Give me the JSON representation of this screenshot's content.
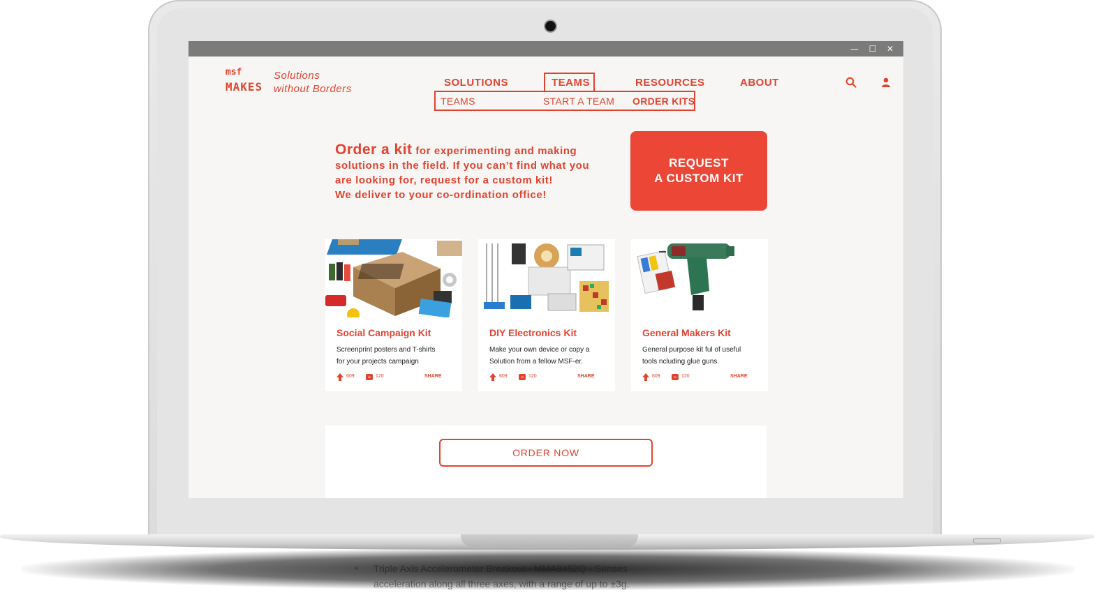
{
  "window": {
    "minimize_glyph": "—",
    "maximize_glyph": "☐",
    "close_glyph": "✕"
  },
  "brand": {
    "logo_top": "msf",
    "logo_bottom": "MAKES",
    "tagline_line1": "Solutions",
    "tagline_line2": "without Borders",
    "accent_color": "#e2432f"
  },
  "nav": {
    "items": [
      {
        "label": "SOLUTIONS"
      },
      {
        "label": "TEAMS"
      },
      {
        "label": "RESOURCES"
      },
      {
        "label": "ABOUT"
      }
    ],
    "active": "TEAMS"
  },
  "submenu": {
    "items": [
      {
        "label": "TEAMS"
      },
      {
        "label": "START A TEAM"
      },
      {
        "label": "ORDER KITS"
      }
    ],
    "active": "ORDER KITS"
  },
  "header_icons": {
    "search": "search-icon",
    "user": "user-icon"
  },
  "intro": {
    "lead": "Order a kit",
    "rest": " for experimenting and making solutions in the field. If you can’t find what you are looking for, request for a custom kit!",
    "line_last": "We deliver to your co-ordination office!"
  },
  "request_button": {
    "line1": "REQUEST",
    "line2": "A CUSTOM KIT"
  },
  "kits": [
    {
      "title": "Social Campaign Kit",
      "desc_line1": "Screenprint posters and T-shirts",
      "desc_line2": "for your projects campaign",
      "upvotes": "609",
      "comments": "120",
      "share": "SHARE"
    },
    {
      "title": "DIY Electronics Kit",
      "desc_line1": "Make your own device or copy a",
      "desc_line2": "Solution from a fellow MSF-er.",
      "upvotes": "609",
      "comments": "120",
      "share": "SHARE"
    },
    {
      "title": "General Makers Kit",
      "desc_line1": "General purpose kit ful of useful",
      "desc_line2": "tools ncluding glue guns.",
      "upvotes": "609",
      "comments": "120",
      "share": "SHARE"
    }
  ],
  "order_button": {
    "label": "ORDER NOW"
  },
  "below_screen_text": {
    "line1": "Triple Axis Accelerometer Breakout - MMA8452Q - Senses",
    "line2": "acceleration along all three axes, with a range of up to ±3g."
  }
}
